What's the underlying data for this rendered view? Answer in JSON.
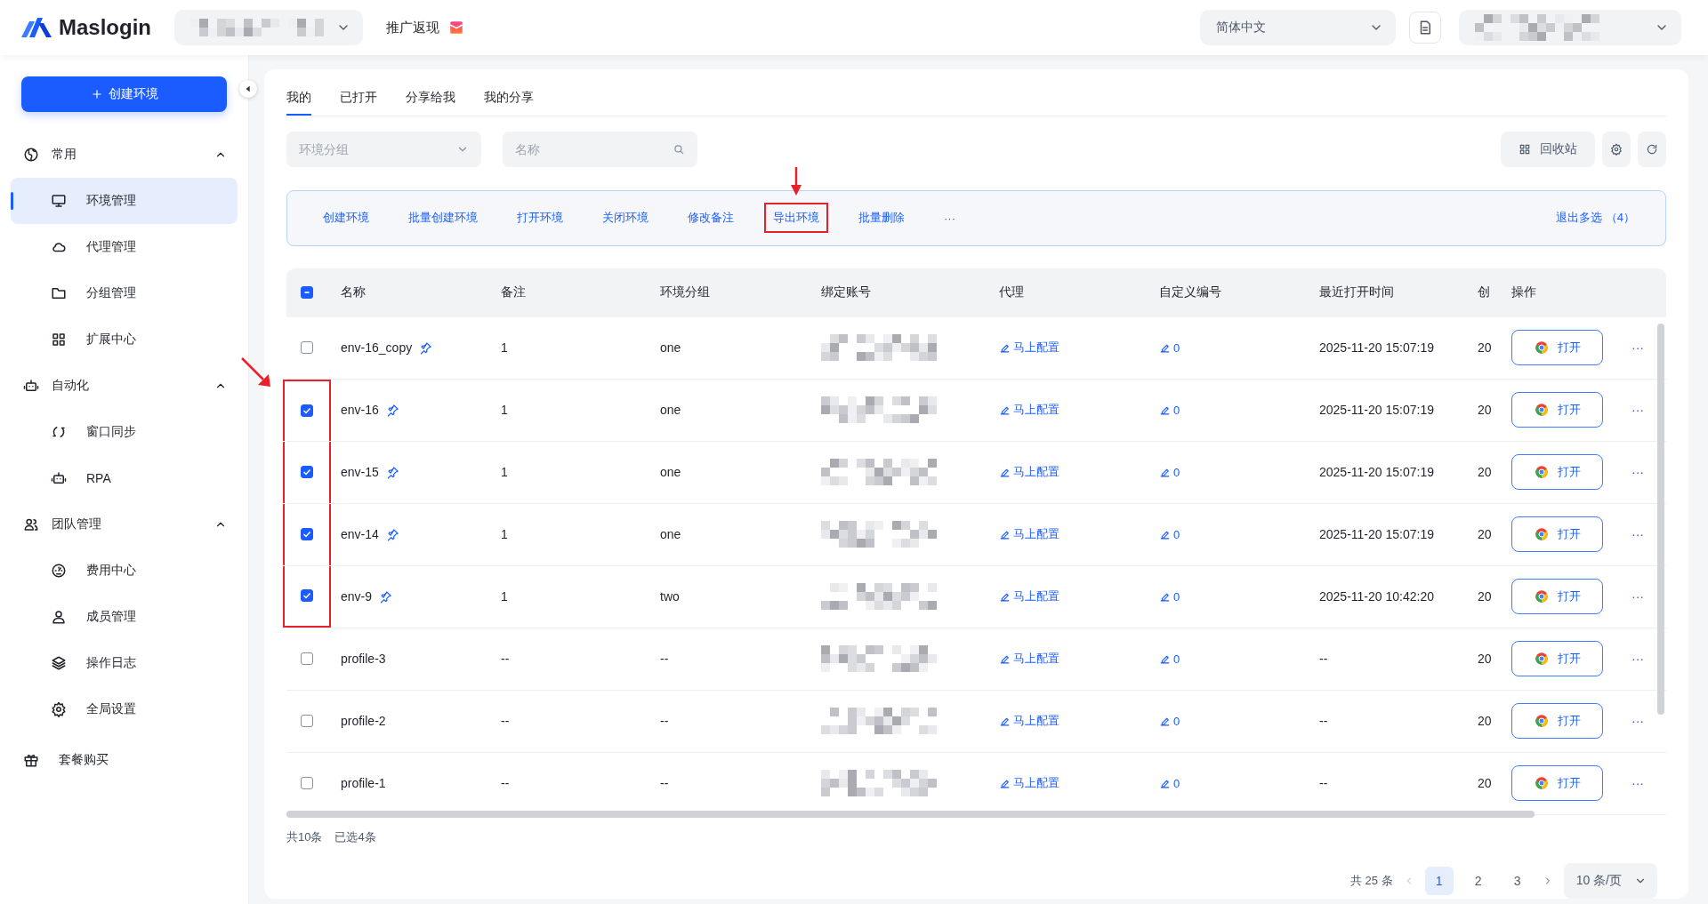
{
  "header": {
    "logo": "Maslogin",
    "promo": "推广返现",
    "language": "简体中文"
  },
  "sidebar": {
    "create_button": "创建环境",
    "sections": [
      {
        "title": "常用",
        "expanded": true,
        "items": [
          {
            "label": "环境管理",
            "selected": true
          },
          {
            "label": "代理管理",
            "selected": false
          },
          {
            "label": "分组管理",
            "selected": false
          },
          {
            "label": "扩展中心",
            "selected": false
          }
        ]
      },
      {
        "title": "自动化",
        "expanded": true,
        "items": [
          {
            "label": "窗口同步",
            "selected": false
          },
          {
            "label": "RPA",
            "selected": false
          }
        ]
      },
      {
        "title": "团队管理",
        "expanded": true,
        "items": [
          {
            "label": "费用中心",
            "selected": false
          },
          {
            "label": "成员管理",
            "selected": false
          },
          {
            "label": "操作日志",
            "selected": false
          },
          {
            "label": "全局设置",
            "selected": false
          }
        ]
      }
    ],
    "footer_item": "套餐购买"
  },
  "tabs": [
    {
      "label": "我的",
      "selected": true
    },
    {
      "label": "已打开",
      "selected": false
    },
    {
      "label": "分享给我",
      "selected": false
    },
    {
      "label": "我的分享",
      "selected": false
    }
  ],
  "filters": {
    "group_placeholder": "环境分组",
    "search_placeholder": "名称"
  },
  "tools": {
    "recycle_bin": "回收站"
  },
  "batch_actions": [
    {
      "label": "创建环境",
      "annotated": false
    },
    {
      "label": "批量创建环境",
      "annotated": false
    },
    {
      "label": "打开环境",
      "annotated": false
    },
    {
      "label": "关闭环境",
      "annotated": false
    },
    {
      "label": "修改备注",
      "annotated": false
    },
    {
      "label": "导出环境",
      "annotated": true
    },
    {
      "label": "批量删除",
      "annotated": false
    },
    {
      "label": "···",
      "annotated": false
    }
  ],
  "exit_multi_select": "退出多选 （4）",
  "table": {
    "select_all_indeterminate": true,
    "checkbox_annotated": true,
    "columns": [
      "名称",
      "备注",
      "环境分组",
      "绑定账号",
      "代理",
      "自定义编号",
      "最近打开时间",
      "创",
      "操作"
    ],
    "rows": [
      {
        "selected": false,
        "name": "env-16_copy",
        "pinned": true,
        "note": "1",
        "group": "one",
        "proxy": "马上配置",
        "custom_no": "0",
        "last_opened": "2025-11-20 15:07:19",
        "created": "20",
        "open": "打开",
        "more": "···"
      },
      {
        "selected": true,
        "name": "env-16",
        "pinned": true,
        "note": "1",
        "group": "one",
        "proxy": "马上配置",
        "custom_no": "0",
        "last_opened": "2025-11-20 15:07:19",
        "created": "20",
        "open": "打开",
        "more": "···"
      },
      {
        "selected": true,
        "name": "env-15",
        "pinned": true,
        "note": "1",
        "group": "one",
        "proxy": "马上配置",
        "custom_no": "0",
        "last_opened": "2025-11-20 15:07:19",
        "created": "20",
        "open": "打开",
        "more": "···"
      },
      {
        "selected": true,
        "name": "env-14",
        "pinned": true,
        "note": "1",
        "group": "one",
        "proxy": "马上配置",
        "custom_no": "0",
        "last_opened": "2025-11-20 15:07:19",
        "created": "20",
        "open": "打开",
        "more": "···"
      },
      {
        "selected": true,
        "name": "env-9",
        "pinned": true,
        "note": "1",
        "group": "two",
        "proxy": "马上配置",
        "custom_no": "0",
        "last_opened": "2025-11-20 10:42:20",
        "created": "20",
        "open": "打开",
        "more": "···"
      },
      {
        "selected": false,
        "name": "profile-3",
        "pinned": false,
        "note": "--",
        "group": "--",
        "proxy": "马上配置",
        "custom_no": "0",
        "last_opened": "--",
        "created": "20",
        "open": "打开",
        "more": "···"
      },
      {
        "selected": false,
        "name": "profile-2",
        "pinned": false,
        "note": "--",
        "group": "--",
        "proxy": "马上配置",
        "custom_no": "0",
        "last_opened": "--",
        "created": "20",
        "open": "打开",
        "more": "···"
      },
      {
        "selected": false,
        "name": "profile-1",
        "pinned": false,
        "note": "--",
        "group": "--",
        "proxy": "马上配置",
        "custom_no": "0",
        "last_opened": "--",
        "created": "20",
        "open": "打开",
        "more": "···"
      }
    ]
  },
  "summary": {
    "total": "共10条",
    "selected": "已选4条"
  },
  "pagination": {
    "total": "共 25 条",
    "pages": [
      {
        "label": "1",
        "selected": true
      },
      {
        "label": "2",
        "selected": false
      },
      {
        "label": "3",
        "selected": false
      }
    ],
    "page_size": "10 条/页"
  }
}
